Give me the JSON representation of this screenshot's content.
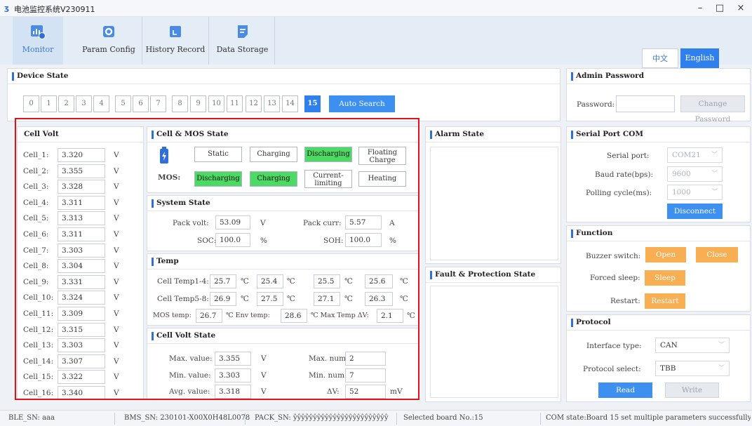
{
  "window": {
    "title": "电池监控系统V230911",
    "icon": "app-logo-icon",
    "min": "–",
    "max": "□",
    "close": "×"
  },
  "nav": [
    {
      "label": "Monitor",
      "icon": "monitor-chart-icon",
      "active": true
    },
    {
      "label": "Param Config",
      "icon": "gear-icon"
    },
    {
      "label": "History Record",
      "icon": "history-icon"
    },
    {
      "label": "Data Storage",
      "icon": "document-icon"
    }
  ],
  "lang": {
    "zh": "中文",
    "en": "English"
  },
  "device_state": {
    "title": "Device State",
    "boards": [
      "0",
      "1",
      "2",
      "3",
      "4",
      "5",
      "6",
      "7",
      "8",
      "9",
      "10",
      "11",
      "12",
      "13",
      "14",
      "15"
    ],
    "active_board": "15",
    "auto_search": "Auto Search"
  },
  "admin": {
    "title": "Admin Password",
    "password_label": "Password:",
    "password_value": "",
    "change_btn": "Change Password"
  },
  "cell_volt": {
    "title": "Cell Volt",
    "unit": "V",
    "cells": [
      {
        "label": "Cell_1:",
        "value": "3.320"
      },
      {
        "label": "Cell_2:",
        "value": "3.355"
      },
      {
        "label": "Cell_3:",
        "value": "3.328"
      },
      {
        "label": "Cell_4:",
        "value": "3.311"
      },
      {
        "label": "Cell_5:",
        "value": "3.313"
      },
      {
        "label": "Cell_6:",
        "value": "3.311"
      },
      {
        "label": "Cell_7:",
        "value": "3.303"
      },
      {
        "label": "Cell_8:",
        "value": "3.304"
      },
      {
        "label": "Cell_9:",
        "value": "3.331"
      },
      {
        "label": "Cell_10:",
        "value": "3.324"
      },
      {
        "label": "Cell_11:",
        "value": "3.309"
      },
      {
        "label": "Cell_12:",
        "value": "3.315"
      },
      {
        "label": "Cell_13:",
        "value": "3.303"
      },
      {
        "label": "Cell_14:",
        "value": "3.307"
      },
      {
        "label": "Cell_15:",
        "value": "3.322"
      },
      {
        "label": "Cell_16:",
        "value": "3.340"
      }
    ]
  },
  "cell_mos": {
    "title": "Cell & MOS State",
    "battery_icon": "battery-charge-icon",
    "battery_states": [
      {
        "label": "Static",
        "on": false
      },
      {
        "label": "Charging",
        "on": false
      },
      {
        "label": "Discharging",
        "on": true
      },
      {
        "label": "Floating\nCharge",
        "on": false
      }
    ],
    "mos_label": "MOS:",
    "mos_states": [
      {
        "label": "Discharging",
        "on": true
      },
      {
        "label": "Charging",
        "on": true
      },
      {
        "label": "Current-\nlimiting",
        "on": false
      },
      {
        "label": "Heating",
        "on": false
      }
    ]
  },
  "system": {
    "title": "System State",
    "pack_volt_label": "Pack volt:",
    "pack_volt": "53.09",
    "pack_volt_unit": "V",
    "pack_curr_label": "Pack curr:",
    "pack_curr": "5.57",
    "pack_curr_unit": "A",
    "soc_label": "SOC:",
    "soc": "100.0",
    "soc_unit": "%",
    "soh_label": "SOH:",
    "soh": "100.0",
    "soh_unit": "%"
  },
  "temp": {
    "title": "Temp",
    "row1_label": "Cell Temp1-4:",
    "row1": [
      "25.7",
      "25.4",
      "25.5",
      "25.6"
    ],
    "row2_label": "Cell Temp5-8:",
    "row2": [
      "26.9",
      "27.5",
      "27.1",
      "26.3"
    ],
    "unit": "℃",
    "mos_label": "MOS temp:",
    "mos": "26.7",
    "env_label": "℃ Env temp:",
    "env": "28.6",
    "max_label": "℃ Max Temp ΔV:",
    "max": "2.1"
  },
  "cvs": {
    "title": "Cell Volt State",
    "max_label": "Max. value:",
    "max": "3.355",
    "max_unit": "V",
    "maxnum_label": "Max. num:",
    "maxnum": "2",
    "min_label": "Min. value:",
    "min": "3.303",
    "min_unit": "V",
    "minnum_label": "Min. num:",
    "minnum": "7",
    "avg_label": "Avg. value:",
    "avg": "3.318",
    "avg_unit": "V",
    "dv_label": "ΔV:",
    "dv": "52",
    "dv_unit": "mV"
  },
  "alarm": {
    "title": "Alarm State"
  },
  "fault": {
    "title": "Fault & Protection State"
  },
  "serial": {
    "title": "Serial Port COM",
    "port_label": "Serial port:",
    "port": "COM21",
    "baud_label": "Baud rate(bps):",
    "baud": "9600",
    "poll_label": "Polling cycle(ms):",
    "poll": "1000",
    "disconnect": "Disconnect"
  },
  "function": {
    "title": "Function",
    "buzzer_label": "Buzzer switch:",
    "open": "Open",
    "close": "Close",
    "sleep_label": "Forced sleep:",
    "sleep": "Sleep",
    "restart_label": "Restart:",
    "restart": "Restart"
  },
  "protocol": {
    "title": "Protocol",
    "iface_label": "Interface type:",
    "iface": "CAN",
    "proto_label": "Protocol select:",
    "proto": "TBB",
    "read": "Read",
    "write": "Write"
  },
  "status_bar": {
    "ble": "BLE_SN: aaa",
    "bms": "BMS_SN: 230101-X00X0H48L0078",
    "pack": "PACK_SN: ŷŷŷŷŷŷŷŷŷŷŷŷŷŷŷŷŷŷŷŷŷŷŷŷ",
    "board": "Selected board No.:15",
    "com": "COM state:Board 15 set multiple parameters successfully"
  },
  "colors": {
    "accent": "#2f80ed",
    "on_state": "#4cd964",
    "orange": "#f8ae53",
    "highlight": "#e0131b"
  }
}
